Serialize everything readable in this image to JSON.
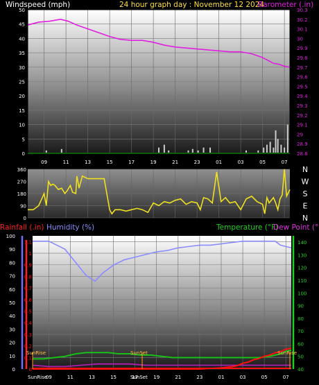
{
  "header": {
    "wind_label": "Windspeed (mph)",
    "title": "24 hour graph day : November 12 2024",
    "baro_label": "Barometer (.in)"
  },
  "lower_header": {
    "rain_label": "Rainfall (.in)",
    "humidity_label": "Humidity (%)",
    "temp_label": "Temperature (°F)",
    "dew_label": "Dew Point (°F)"
  },
  "colors": {
    "wind": "#cccccc",
    "barometer": "#e020e0",
    "direction": "#f0e020",
    "rain": "#ff1010",
    "humidity": "#8a8cff",
    "temperature": "#18c018",
    "dewpoint": "#b020b0",
    "title": "#ffe040",
    "temp_axis": "#20d020",
    "rain_axis": "#ff2020",
    "humidity_axis": "#7070ff"
  },
  "hour_labels": [
    "09",
    "11",
    "13",
    "15",
    "17",
    "19",
    "21",
    "23",
    "01",
    "03",
    "05",
    "07"
  ],
  "bottom_hour_labels": [
    "09",
    "11",
    "13",
    "15",
    "17",
    "19",
    "21",
    "23",
    "01",
    "03",
    "05",
    "07"
  ],
  "sun_labels": {
    "sunrise": "SunRise",
    "sunset": "SunSet",
    "bottom_sunrise": "SunRise",
    "bottom_sunset": "SunSet"
  },
  "chart_data": [
    {
      "type": "line",
      "name": "wind-barometer",
      "left_axis": {
        "label": "Windspeed (mph)",
        "ticks": [
          "0",
          "5",
          "10",
          "15",
          "20",
          "25",
          "30",
          "35",
          "40",
          "45",
          "50"
        ],
        "ylim": [
          0,
          50
        ]
      },
      "right_axis": {
        "label": "Barometer (.in)",
        "ticks": [
          "28.8",
          "28.9",
          "29",
          "29.1",
          "29.2",
          "29.3",
          "29.4",
          "29.5",
          "29.6",
          "29.7",
          "29.8",
          "29.9",
          "30",
          "30.1",
          "30.2",
          "30.3"
        ],
        "ylim": [
          28.8,
          30.3
        ]
      },
      "xlim": [
        7.5,
        31.5
      ],
      "series": [
        {
          "values_key": "barometer",
          "axis": "right",
          "x": [
            7.5,
            8.5,
            9.5,
            10.5,
            11.2,
            12,
            13,
            14,
            15,
            16,
            17,
            18,
            19,
            20,
            21,
            22,
            23,
            24,
            25,
            26,
            27,
            28,
            29,
            29.5,
            30,
            30.5,
            31,
            31.5
          ],
          "y": [
            30.14,
            30.17,
            30.18,
            30.2,
            30.18,
            30.14,
            30.1,
            30.06,
            30.02,
            29.99,
            29.98,
            29.98,
            29.96,
            29.93,
            29.91,
            29.9,
            29.89,
            29.88,
            29.87,
            29.86,
            29.86,
            29.84,
            29.8,
            29.77,
            29.74,
            29.73,
            29.71,
            29.7
          ]
        },
        {
          "values_key": "wind",
          "axis": "left",
          "type": "bar",
          "x": [
            9.2,
            10.6,
            19.5,
            20.0,
            20.4,
            22.2,
            22.6,
            23.1,
            23.6,
            24.2,
            27.5,
            28.6,
            29.1,
            29.4,
            29.7,
            30.0,
            30.2,
            30.4,
            30.7,
            31.0,
            31.3
          ],
          "y": [
            1,
            1.5,
            2,
            3,
            1,
            1,
            1.5,
            1,
            2,
            2,
            1,
            1,
            2,
            3,
            4,
            2,
            8,
            5,
            3,
            2,
            10
          ]
        }
      ]
    },
    {
      "type": "line",
      "name": "wind-direction",
      "left_axis": {
        "ticks": [
          "0",
          "90",
          "180",
          "270",
          "360"
        ],
        "ylim": [
          0,
          360
        ]
      },
      "right_axis": {
        "ticks": [
          "N",
          "W",
          "S",
          "E",
          "N"
        ]
      },
      "xlim": [
        7.5,
        31.5
      ],
      "series": [
        {
          "values_key": "direction",
          "x": [
            7.5,
            8,
            8.5,
            9,
            9.2,
            9.4,
            9.6,
            9.8,
            10,
            10.3,
            10.6,
            10.9,
            11.1,
            11.4,
            11.6,
            11.9,
            12,
            12.2,
            12.5,
            13,
            13.5,
            14,
            14.5,
            15,
            15.2,
            15.5,
            16,
            16.5,
            17,
            17.5,
            18,
            18.5,
            19,
            19.5,
            20,
            20.5,
            21,
            21.5,
            22,
            22.5,
            23,
            23.3,
            23.6,
            24,
            24.4,
            24.8,
            25.2,
            25.6,
            26,
            26.5,
            27,
            27.5,
            28,
            28.5,
            29,
            29.2,
            29.4,
            29.6,
            29.8,
            30,
            30.2,
            30.4,
            30.6,
            30.8,
            31,
            31.2,
            31.5
          ],
          "y": [
            60,
            60,
            90,
            180,
            90,
            270,
            240,
            250,
            240,
            210,
            220,
            180,
            200,
            240,
            190,
            180,
            310,
            220,
            310,
            290,
            290,
            290,
            290,
            60,
            30,
            60,
            60,
            50,
            60,
            70,
            60,
            40,
            110,
            90,
            120,
            110,
            130,
            140,
            100,
            120,
            110,
            60,
            150,
            140,
            110,
            340,
            120,
            150,
            110,
            120,
            60,
            140,
            160,
            120,
            100,
            30,
            150,
            110,
            130,
            150,
            110,
            60,
            140,
            170,
            360,
            160,
            210
          ]
        }
      ]
    },
    {
      "type": "line",
      "name": "rain-humidity-temperature",
      "rain_axis": {
        "label": "Rainfall (.in)",
        "ticks": [
          "0",
          "0.1",
          "0.2",
          "0.3",
          "0.4",
          "0.5",
          "0.6",
          "0.7",
          "0.8",
          "0.9",
          "1",
          "1.1"
        ],
        "ylim": [
          0,
          1.15
        ]
      },
      "humidity_axis": {
        "label": "Humidity (%)",
        "ticks": [
          "0",
          "10",
          "20",
          "30",
          "40",
          "50",
          "60",
          "70",
          "80",
          "90",
          "100"
        ],
        "ylim": [
          0,
          100
        ]
      },
      "temp_axis": {
        "label": "Temperature (°F)",
        "ticks": [
          "40",
          "50",
          "60",
          "70",
          "80",
          "90",
          "100",
          "110",
          "120",
          "130",
          "140"
        ],
        "ylim": [
          40,
          145
        ]
      },
      "xlim": [
        7.5,
        31.5
      ],
      "series": [
        {
          "values_key": "humidity",
          "axis": "humidity",
          "x": [
            7.5,
            9,
            10.5,
            11.5,
            12.5,
            13.3,
            14,
            15,
            16,
            17,
            18,
            19,
            20,
            21,
            22,
            23,
            24,
            25,
            26,
            27,
            28,
            29,
            30,
            30.5,
            31,
            31.5
          ],
          "y": [
            96,
            96,
            90,
            80,
            70,
            66,
            72,
            78,
            82,
            84,
            86,
            88,
            89,
            91,
            92,
            93,
            93,
            94,
            95,
            96,
            96,
            96,
            96,
            93,
            92,
            91
          ]
        },
        {
          "values_key": "temperature",
          "axis": "temp",
          "x": [
            7.5,
            8.5,
            9.5,
            10.5,
            11.5,
            12.5,
            13.5,
            14.5,
            15.5,
            16.5,
            17.5,
            18.5,
            19.5,
            20.5,
            21.5,
            22.5,
            23.5,
            24.5,
            25.5,
            26.5,
            27.5,
            28.5,
            29.5,
            30,
            30.5,
            31,
            31.5
          ],
          "y": [
            48,
            48,
            49,
            50,
            52,
            53,
            53,
            53,
            52,
            52,
            51,
            51,
            50,
            49,
            49,
            49,
            49,
            49,
            49,
            49,
            49,
            49,
            50,
            51,
            52,
            54,
            55
          ]
        },
        {
          "values_key": "dewpoint",
          "axis": "temp",
          "x": [
            7.5,
            9,
            10.5,
            12,
            13.5,
            15,
            16.5,
            18,
            19.5,
            21,
            22.5,
            24,
            25.5,
            27,
            28.5,
            29.5,
            30.5,
            31.5
          ],
          "y": [
            43,
            42,
            42,
            43,
            44,
            44,
            44,
            43,
            43,
            43,
            43,
            43,
            43,
            43,
            43,
            43,
            43,
            43
          ]
        },
        {
          "values_key": "rain",
          "axis": "rain",
          "x": [
            7.5,
            19,
            21,
            23,
            24,
            25,
            26,
            26.5,
            27,
            27.5,
            28,
            28.5,
            29,
            29.5,
            30,
            30.5,
            31,
            31.5
          ],
          "y": [
            0,
            0,
            0,
            0,
            0.005,
            0.01,
            0.02,
            0.03,
            0.05,
            0.06,
            0.08,
            0.09,
            0.11,
            0.12,
            0.14,
            0.15,
            0.17,
            0.18
          ]
        }
      ]
    }
  ]
}
